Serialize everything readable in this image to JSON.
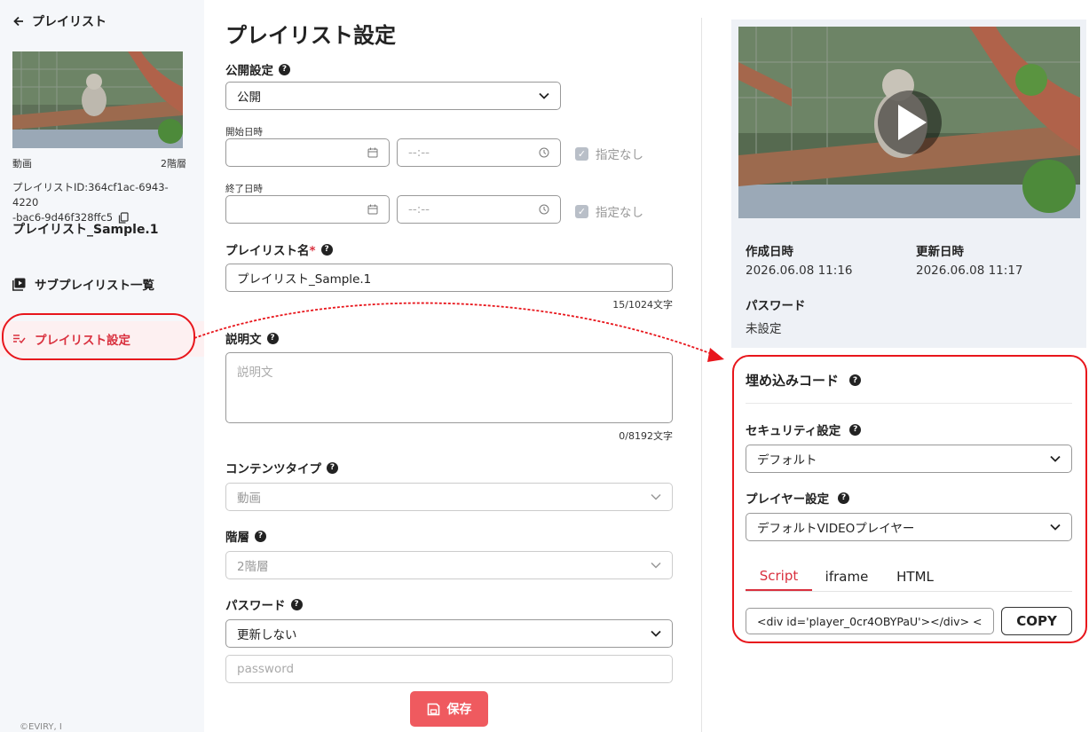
{
  "sidebar": {
    "back_label": "プレイリスト",
    "content_type": "動画",
    "hierarchy": "2階層",
    "playlist_id_line1": "プレイリストID:364cf1ac-6943-4220",
    "playlist_id_line2": "-bac6-9d46f328ffc5",
    "playlist_name": "プレイリスト_Sample.1",
    "nav_sub": "サブプレイリスト一覧",
    "nav_settings": "プレイリスト設定",
    "copyright": "©EVIRY, I"
  },
  "form": {
    "title": "プレイリスト設定",
    "visibility_label": "公開設定",
    "visibility_value": "公開",
    "start_label": "開始日時",
    "end_label": "終了日時",
    "time_placeholder": "--:--",
    "unset_label": "指定なし",
    "name_label": "プレイリスト名",
    "required_mark": "*",
    "name_value": "プレイリスト_Sample.1",
    "name_counter": "15/1024文字",
    "desc_label": "説明文",
    "desc_placeholder": "説明文",
    "desc_counter": "0/8192文字",
    "content_type_label": "コンテンツタイプ",
    "content_type_value": "動画",
    "hierarchy_label": "階層",
    "hierarchy_value": "2階層",
    "password_label": "パスワード",
    "password_mode": "更新しない",
    "password_placeholder": "password",
    "save_label": "保存"
  },
  "info": {
    "created_label": "作成日時",
    "created_value": "2026.06.08 11:16",
    "updated_label": "更新日時",
    "updated_value": "2026.06.08 11:17",
    "password_label": "パスワード",
    "password_value": "未設定"
  },
  "embed": {
    "title": "埋め込みコード",
    "security_label": "セキュリティ設定",
    "security_value": "デフォルト",
    "player_label": "プレイヤー設定",
    "player_value": "デフォルトVIDEOプレイヤー",
    "tabs": [
      "Script",
      "iframe",
      "HTML"
    ],
    "code_value": "<div id='player_0cr4OBYPaU'></div> <",
    "copy_label": "COPY"
  },
  "colors": {
    "accent": "#d9303e",
    "save": "#ef5a5f",
    "annotation": "#e8161c"
  }
}
